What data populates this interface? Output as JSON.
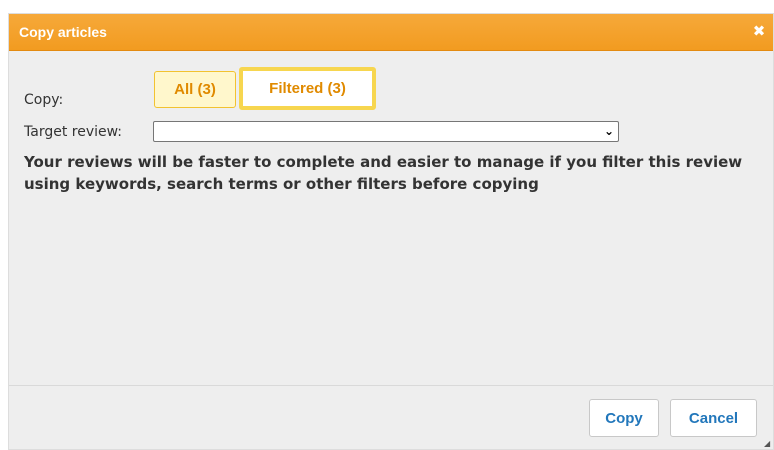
{
  "dialog": {
    "title": "Copy articles",
    "close_icon": "close-icon",
    "copy_label": "Copy:",
    "options": {
      "all_label": "All (3)",
      "filtered_label": "Filtered (3)",
      "selected": "Filtered (3)"
    },
    "target_review_label": "Target review:",
    "target_review_value": "",
    "info_text": "Your reviews will be faster to complete and easier to manage if you filter this review using keywords, search terms or other filters before copying",
    "buttons": {
      "copy": "Copy",
      "cancel": "Cancel"
    }
  },
  "colors": {
    "titlebar": "#f29b20",
    "accent_text": "#e08a00",
    "selected_border": "#f7d64f",
    "button_text": "#2277bb"
  }
}
